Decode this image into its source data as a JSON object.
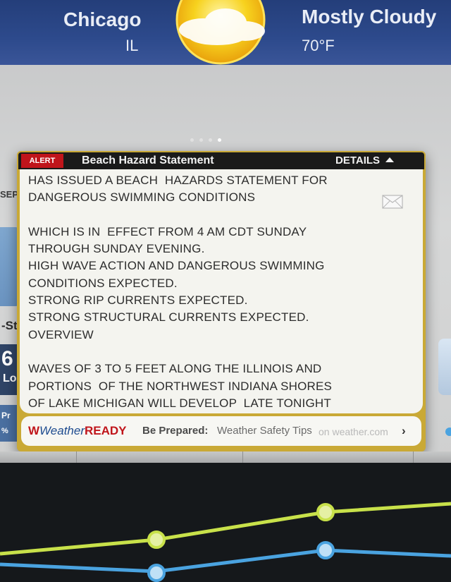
{
  "header": {
    "city": "Chicago",
    "state": "IL",
    "condition": "Mostly Cloudy",
    "temperature": "70°F",
    "weather_icon": "sun-cloud-icon"
  },
  "pager": {
    "count": 4,
    "active": 3
  },
  "background_fragments": {
    "sep": "SEP",
    "st": "-St",
    "six": "6",
    "lo": "Lo",
    "pr": "Pr",
    "pct": "%"
  },
  "alert": {
    "tag": "ALERT",
    "title": "Beach Hazard Statement",
    "details_label": "DETAILS",
    "lines": [
      "HAS ISSUED A BEACH  HAZARDS STATEMENT FOR",
      "DANGEROUS SWIMMING CONDITIONS",
      "",
      "WHICH IS IN  EFFECT FROM 4 AM CDT SUNDAY",
      "THROUGH SUNDAY EVENING.",
      "HIGH WAVE ACTION AND DANGEROUS SWIMMING",
      "CONDITIONS EXPECTED.",
      "STRONG RIP CURRENTS EXPECTED.",
      "STRONG STRUCTURAL CURRENTS EXPECTED.",
      "OVERVIEW",
      "",
      "WAVES OF 3 TO 5 FEET ALONG THE ILLINOIS AND",
      "PORTIONS  OF THE NORTHWEST INDIANA SHORES",
      "OF LAKE MICHIGAN WILL DEVELOP  LATE TONIGHT"
    ],
    "share_icon": "mail-icon"
  },
  "weather_ready": {
    "logo_w": "W",
    "logo_weather": "Weather",
    "logo_ready": "READY",
    "prepared": "Be Prepared:",
    "tips": "Weather Safety Tips",
    "site": "on weather.com",
    "chevron": "›"
  },
  "colors": {
    "header_blue": "#2d4a8c",
    "alert_red": "#c0151b",
    "alert_gold": "#c9a936",
    "chart_yellow": "#c8e14a",
    "chart_blue": "#4aa3e0"
  }
}
